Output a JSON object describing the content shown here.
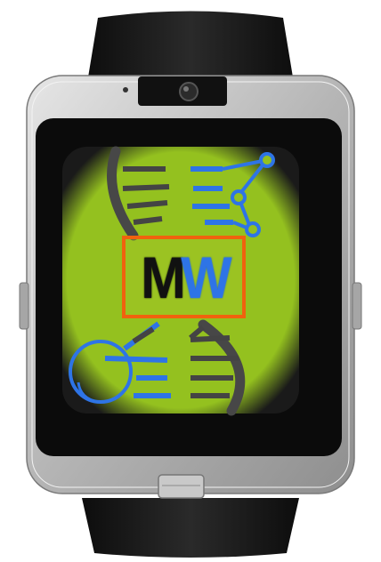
{
  "device": {
    "type": "smartwatch",
    "colors": {
      "strap": "#1c1c1c",
      "bezel": "#b8b8b8",
      "screen_background": "#94c11f",
      "logo_border": "#f0620e",
      "logo_letter_m": "#111111",
      "logo_letter_w": "#2e74e6",
      "dna_strand": "#444444",
      "dna_accent": "#2e74e6"
    }
  },
  "screen": {
    "logo": {
      "letter_m": "M",
      "letter_w": "W"
    },
    "icons": [
      "dna-helix-icon",
      "magnifying-glass-icon",
      "molecule-network-icon"
    ]
  }
}
